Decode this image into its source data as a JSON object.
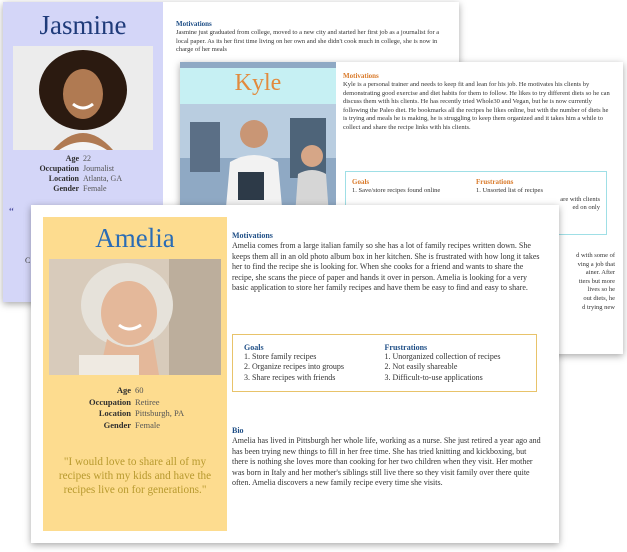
{
  "jasmine": {
    "name": "Jasmine",
    "age": "22",
    "occupation": "Journalist",
    "location": "Atlanta, GA",
    "gender": "Female",
    "labels": {
      "age": "Age",
      "occupation": "Occupation",
      "location": "Location",
      "gender": "Gender"
    },
    "motivations_title": "Motivations",
    "motivations_text": "Jasmine just graduated from college, moved to a new city and started her first job as a journalist for a local paper. As its her first time living on her own and she didn't cook much in college, she is now in charge of her meals",
    "quote_fragment": "“",
    "side_fragment": "C"
  },
  "kyle": {
    "name": "Kyle",
    "motivations_title": "Motivations",
    "motivations_text": "Kyle is a personal trainer and needs to keep fit and lean for his job. He motivates his clients by demonstrating good exercise and diet habits for them to follow. He likes to try different diets so he can discuss them with his clients. He has recently tried Whole30 and Vegan, but he is now currently following the Paleo diet. He bookmarks all the recipes he likes online, but with the number of diets he is trying and meals he is making, he is struggling to keep them organized and it takes him a while to collect and share the recipe links with his clients.",
    "goals_title": "Goals",
    "goals": [
      "1. Save/store recipes found online"
    ],
    "frustrations_title": "Frustrations",
    "frustrations": [
      "1. Unsorted list of recipes",
      "are with clients",
      "ed on only"
    ],
    "continued": [
      "d with some of",
      "ving a job that",
      "ainer. After",
      "tters but more",
      "lives so he",
      "out diets, he",
      "d trying new"
    ]
  },
  "amelia": {
    "name": "Amelia",
    "age": "60",
    "occupation": "Retiree",
    "location": "Pittsburgh, PA",
    "gender": "Female",
    "labels": {
      "age": "Age",
      "occupation": "Occupation",
      "location": "Location",
      "gender": "Gender"
    },
    "quote": "\"I would love to share all of my recipes with my kids and have the recipes live on for generations.\"",
    "motivations_title": "Motivations",
    "motivations_text": "Amelia comes from a large italian family so she has a lot of family recipes written down. She keeps them all in an old photo album box in her kitchen. She is frustrated with how long it takes her to find the recipe she is looking for. When she cooks for a friend and wants to share the recipe, she scans the piece of paper and hands it over in person. Amelia is looking for a very basic application to store her family recipes and have them be easy to find and easy to share.",
    "goals_title": "Goals",
    "goals": [
      "1. Store family recipes",
      "2. Organize recipes into groups",
      "3. Share recipes with friends"
    ],
    "frustrations_title": "Frustrations",
    "frustrations": [
      "1. Unorganized collection of recipes",
      "2. Not easily shareable",
      "3. Difficult-to-use applications"
    ],
    "bio_title": "Bio",
    "bio_text": "Amelia has lived in Pittsburgh her whole life, working as a nurse. She just retired a year ago and has been trying new things to fill in her free time. She has tried knitting and kickboxing, but there is nothing she loves more than cooking for her two children when they visit. Her mother was born in Italy and her mother's siblings still live there so they visit family over there quite often. Amelia discovers a new family recipe every time she visits."
  },
  "colors": {
    "amelia_panel": "#fddc8f",
    "jasmine_panel": "#d4d6f8",
    "kyle_header": "#c6f0f3",
    "heading_blue": "#1e4e86",
    "kyle_orange": "#d97a2a"
  }
}
